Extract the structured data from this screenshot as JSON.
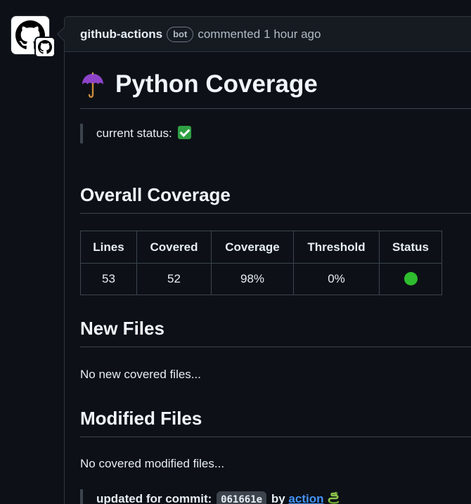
{
  "comment": {
    "author": "github-actions",
    "badge": "bot",
    "action": "commented",
    "time": "1 hour ago"
  },
  "report": {
    "title": "Python Coverage",
    "status_label": "current status:",
    "status_icon": "check-mark-emoji",
    "overall_heading": "Overall Coverage",
    "table": {
      "headers": [
        "Lines",
        "Covered",
        "Coverage",
        "Threshold",
        "Status"
      ],
      "rows": [
        {
          "lines": "53",
          "covered": "52",
          "coverage": "98%",
          "threshold": "0%",
          "status_color": "#2ebd2e"
        }
      ]
    },
    "new_files_heading": "New Files",
    "new_files_text": "No new covered files...",
    "modified_files_heading": "Modified Files",
    "modified_files_text": "No covered modified files...",
    "footer": {
      "prefix": "updated for commit:",
      "commit": "061661e",
      "by": "by",
      "link": "action",
      "emoji": "snake-emoji"
    }
  },
  "colors": {
    "background": "#0d1117",
    "header_background": "#161b22",
    "border": "#30363d",
    "link": "#4493f8",
    "status_green": "#2ebd2e"
  }
}
